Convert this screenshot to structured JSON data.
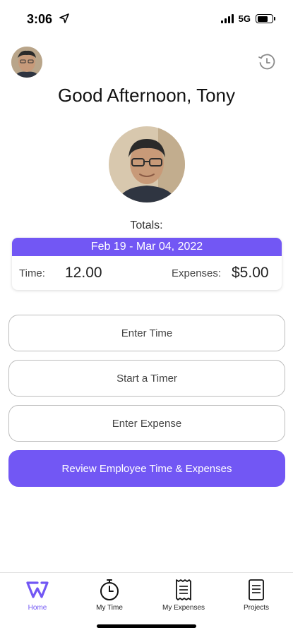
{
  "status": {
    "time": "3:06",
    "network": "5G"
  },
  "header": {
    "greeting": "Good Afternoon, Tony"
  },
  "totals": {
    "label": "Totals:",
    "period": "Feb 19 - Mar 04, 2022",
    "time_label": "Time:",
    "time_value": "12.00",
    "expenses_label": "Expenses:",
    "expenses_value": "$5.00"
  },
  "actions": {
    "enter_time": "Enter Time",
    "start_timer": "Start a Timer",
    "enter_expense": "Enter Expense",
    "review": "Review Employee Time & Expenses"
  },
  "tabs": [
    {
      "label": "Home",
      "icon": "home-logo-icon",
      "active": true
    },
    {
      "label": "My Time",
      "icon": "stopwatch-icon",
      "active": false
    },
    {
      "label": "My Expenses",
      "icon": "receipt-icon",
      "active": false
    },
    {
      "label": "Projects",
      "icon": "document-icon",
      "active": false
    }
  ],
  "colors": {
    "accent": "#7257f4",
    "text": "#1a1a1a",
    "border": "#bcbcbc"
  }
}
